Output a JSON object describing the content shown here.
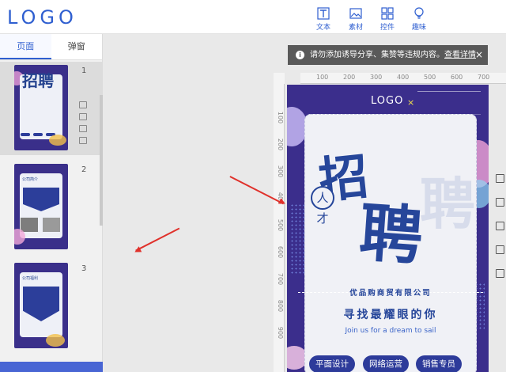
{
  "app": {
    "logo": "LOGO"
  },
  "toolbar": [
    {
      "name": "text",
      "label": "文本",
      "icon": "text-icon"
    },
    {
      "name": "material",
      "label": "素材",
      "icon": "image-icon"
    },
    {
      "name": "widget",
      "label": "控件",
      "icon": "grid-icon"
    },
    {
      "name": "fun",
      "label": "趣味",
      "icon": "bulb-icon"
    }
  ],
  "leftpanel": {
    "tabs": [
      {
        "label": "页面",
        "active": true
      },
      {
        "label": "弹窗",
        "active": false
      }
    ],
    "pages": [
      {
        "number": "1",
        "selected": true,
        "title": "招聘"
      },
      {
        "number": "2",
        "selected": false,
        "title": "公司简介"
      },
      {
        "number": "3",
        "selected": false,
        "title": "公司福利"
      }
    ]
  },
  "notice": {
    "text": "请勿添加诱导分享、集赞等违规内容。",
    "link": "查看详情",
    "close": "×"
  },
  "ruler": {
    "h": [
      "100",
      "200",
      "300",
      "400",
      "500",
      "600",
      "700"
    ],
    "v": [
      "100",
      "200",
      "300",
      "400",
      "500",
      "600",
      "700",
      "800",
      "900"
    ]
  },
  "poster": {
    "logo": "LOGO",
    "logo_mark": "×",
    "headline_1": "招",
    "headline_2": "聘",
    "badge": "人才",
    "company": "优品购商贸有限公司",
    "slogan": "寻找最耀眼的你",
    "english": "Join us for a dream to sail",
    "jobs": [
      "平面设计",
      "网络运营",
      "销售专员"
    ],
    "colors": {
      "bg": "#3b2e8c",
      "primary": "#26469a",
      "accent": "#f1e04a"
    }
  }
}
